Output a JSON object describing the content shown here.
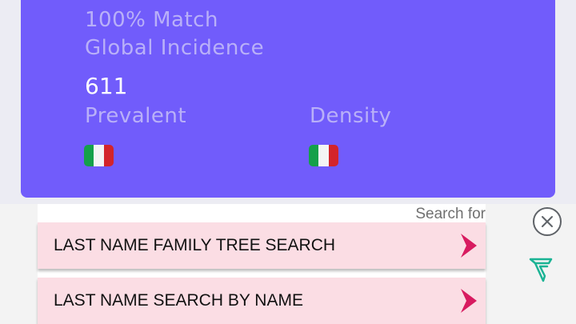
{
  "stats_card": {
    "match_text": "100% Match",
    "section_title": "Global Incidence",
    "count": "611",
    "prevalent_label": "Prevalent",
    "density_label": "Density",
    "prevalent_flag_icon": "italy-flag-icon",
    "density_flag_icon": "italy-flag-icon",
    "card_color": "#715cfb"
  },
  "ad": {
    "header": "Search for",
    "items": [
      {
        "label": "LAST NAME FAMILY TREE SEARCH",
        "icon": "chevron-right-icon"
      },
      {
        "label": "LAST NAME SEARCH BY NAME",
        "icon": "chevron-right-icon"
      }
    ],
    "button_color": "#fbdde4",
    "chevron_color": "#d81b60",
    "close_icon": "close-icon",
    "brand_icon": "ad-brand-icon",
    "brand_color": "#1ab394"
  }
}
